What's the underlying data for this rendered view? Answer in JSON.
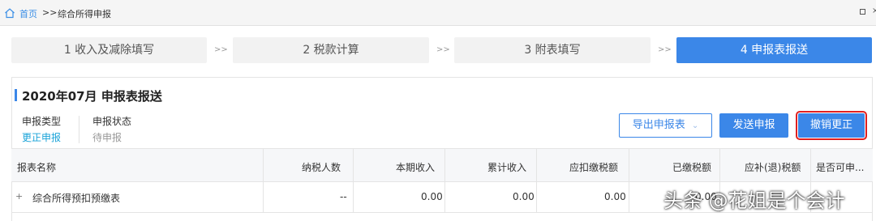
{
  "breadcrumb": {
    "home": "首页",
    "separator": ">>",
    "current": "综合所得申报"
  },
  "window_controls": {
    "restore_icon": "restore-icon",
    "close_glyph": "×"
  },
  "steps": {
    "separator": ">>",
    "items": [
      {
        "label": "1 收入及减除填写",
        "active": false
      },
      {
        "label": "2 税款计算",
        "active": false
      },
      {
        "label": "3 附表填写",
        "active": false
      },
      {
        "label": "4 申报表报送",
        "active": true
      }
    ]
  },
  "section": {
    "title": "2020年07月  申报表报送"
  },
  "meta": {
    "type_label": "申报类型",
    "type_value": "更正申报",
    "status_label": "申报状态",
    "status_value": "待申报"
  },
  "actions": {
    "export": "导出申报表",
    "send": "发送申报",
    "revoke": "撤销更正"
  },
  "table": {
    "headers": [
      "报表名称",
      "纳税人数",
      "本期收入",
      "累计收入",
      "应扣缴税额",
      "已缴税额",
      "应补(退)税额",
      "是否可申..."
    ],
    "rows": [
      {
        "expand": "+",
        "name": "综合所得预扣预缴表",
        "taxpayers": "--",
        "current_income": "0.00",
        "cumulative_income": "0.00",
        "tax_withholding": "0.00",
        "tax_paid": "0.00",
        "tax_due": "",
        "can_declare": ""
      }
    ]
  },
  "watermark": "头条 @花姐是个会计",
  "colors": {
    "accent": "#3b87e8",
    "highlight_border": "#e02020",
    "status_link": "#1aa3d8",
    "pending": "#999999"
  }
}
